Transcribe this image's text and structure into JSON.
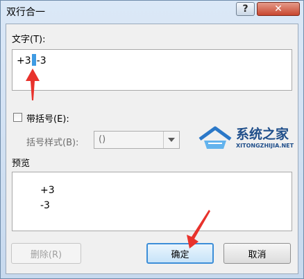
{
  "window": {
    "title": "双行合一",
    "help_glyph": "?",
    "close_glyph": "✕"
  },
  "text_field": {
    "label": "文字(T):",
    "value_before": "+3",
    "value_after": "-3"
  },
  "bracket": {
    "checkbox_label": "带括号(E):",
    "checked": false,
    "style_label": "括号样式(B):",
    "style_value": "()"
  },
  "preview": {
    "label": "预览",
    "line1": "+3",
    "line2": "-3"
  },
  "buttons": {
    "delete": "删除(R)",
    "ok": "确定",
    "cancel": "取消"
  },
  "watermark": {
    "brand": "系统之家",
    "url": "XITONGZHIJIA.NET"
  },
  "colors": {
    "annotation_arrow": "#e8322c",
    "selection_highlight": "#3f9be3",
    "default_button_border": "#3c8ed8"
  }
}
